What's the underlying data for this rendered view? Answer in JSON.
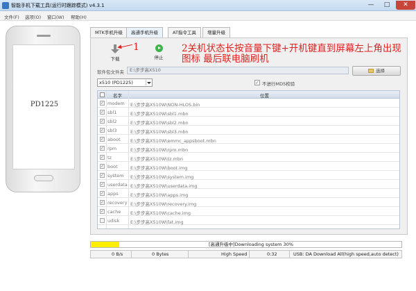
{
  "window": {
    "title": "智能手机下载工具(运行时跟踪模式)  v4.3.1",
    "minimize": "—",
    "maximize": "□",
    "close": "✕"
  },
  "menu": {
    "items": [
      "文件(F)",
      "选项(O)",
      "窗口(W)",
      "帮助(H)"
    ]
  },
  "phone": {
    "label": "PD1225"
  },
  "tabs": [
    {
      "label": "MTK手机升级",
      "active": false
    },
    {
      "label": "高通手机升级",
      "active": true
    },
    {
      "label": "AT指令工具",
      "active": false
    },
    {
      "label": "增量升级",
      "active": false
    }
  ],
  "toolbar": {
    "download_label": "下载",
    "stop_label": "停止"
  },
  "annotation": {
    "number": "1",
    "text": "2关机状态长按音量下键+开机键直到屏幕左上角出现图标  最后联电脑刷机",
    "color": "#e01f1f"
  },
  "package": {
    "folder_label": "软件包文件夹",
    "folder_value": "E:\\步步高X510",
    "browse_label": "选择"
  },
  "model": {
    "selected": "x510 (PD1225)"
  },
  "md5": {
    "label": "不进行MD5校验",
    "checked": true
  },
  "table": {
    "headers": {
      "name": "名字",
      "path": "位置"
    },
    "rows": [
      {
        "name": "modem",
        "path": "E:\\步步高X510W\\NON-HLOS.bin",
        "checked": true
      },
      {
        "name": "sbl1",
        "path": "E:\\步步高X510W\\sbl1.mbn",
        "checked": true
      },
      {
        "name": "sbl2",
        "path": "E:\\步步高X510W\\sbl2.mbn",
        "checked": true
      },
      {
        "name": "sbl3",
        "path": "E:\\步步高X510W\\sbl3.mbn",
        "checked": true
      },
      {
        "name": "aboot",
        "path": "E:\\步步高X510W\\emmc_appsboot.mbn",
        "checked": true
      },
      {
        "name": "rpm",
        "path": "E:\\步步高X510W\\rpm.mbn",
        "checked": true
      },
      {
        "name": "tz",
        "path": "E:\\步步高X510W\\tz.mbn",
        "checked": true
      },
      {
        "name": "boot",
        "path": "E:\\步步高X510W\\boot.img",
        "checked": true
      },
      {
        "name": "system",
        "path": "E:\\步步高X510W\\system.img",
        "checked": true
      },
      {
        "name": "userdata",
        "path": "E:\\步步高X510W\\userdata.img",
        "checked": true
      },
      {
        "name": "apps",
        "path": "E:\\步步高X510W\\apps.img",
        "checked": true
      },
      {
        "name": "recovery",
        "path": "E:\\步步高X510W\\recovery.img",
        "checked": true
      },
      {
        "name": "cache",
        "path": "E:\\步步高X510W\\cache.img",
        "checked": true
      },
      {
        "name": "udisk",
        "path": "E:\\步步高X510W\\fat.img",
        "checked": false
      }
    ]
  },
  "progress": {
    "fraction": 0.3,
    "text": "[高通升级中]Downloading system 30%",
    "fill_color": "#ffee00"
  },
  "status": {
    "speed": "0 B/s",
    "bytes": "0 Bytes",
    "mode": "High Speed",
    "time": "0:32",
    "info": "USB: DA Download All(high speed,auto detect)"
  }
}
